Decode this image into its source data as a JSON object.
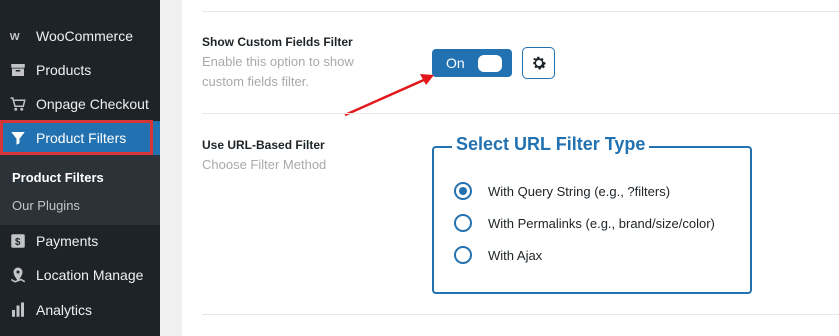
{
  "sidebar": {
    "items": [
      {
        "label": "WooCommerce",
        "icon": "woocommerce-icon"
      },
      {
        "label": "Products",
        "icon": "archive-icon"
      },
      {
        "label": "Onpage Checkout",
        "icon": "cart-icon"
      },
      {
        "label": "Product Filters",
        "icon": "filter-icon",
        "active": true
      },
      {
        "label": "Payments",
        "icon": "dollar-icon"
      },
      {
        "label": "Location Manage",
        "icon": "location-icon"
      },
      {
        "label": "Analytics",
        "icon": "chart-bar-icon"
      }
    ],
    "submenu": [
      {
        "label": "Product Filters",
        "current": true
      },
      {
        "label": "Our Plugins"
      }
    ]
  },
  "settings": {
    "custom_fields": {
      "label": "Show Custom Fields Filter",
      "description": "Enable this option to show custom fields filter.",
      "toggle_label": "On"
    },
    "url_filter": {
      "label": "Use URL-Based Filter",
      "description": "Choose Filter Method",
      "group_title": "Select URL Filter Type",
      "options": [
        {
          "label": "With Query String (e.g., ?filters)",
          "checked": true
        },
        {
          "label": "With Permalinks (e.g., brand/size/color)",
          "checked": false
        },
        {
          "label": "With Ajax",
          "checked": false
        }
      ]
    }
  },
  "colors": {
    "accent": "#2271b1",
    "sidebar_bg": "#1d2327",
    "highlight_outline": "#d63638"
  }
}
